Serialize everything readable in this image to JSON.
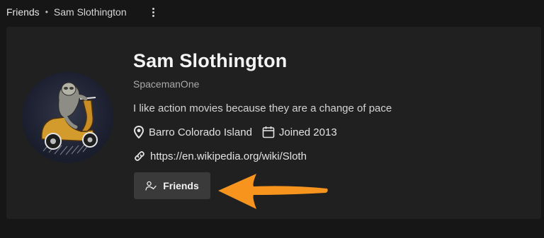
{
  "breadcrumb": {
    "root": "Friends",
    "separator": "•",
    "current": "Sam Slothington"
  },
  "profile": {
    "name": "Sam Slothington",
    "username": "SpacemanOne",
    "bio": "I like action movies because they are a change of pace",
    "location": "Barro Colorado Island",
    "joined": "Joined 2013",
    "website": "https://en.wikipedia.org/wiki/Sloth",
    "avatar_icon": "sloth-on-scooter-illustration"
  },
  "actions": {
    "friends_button_label": "Friends",
    "friends_icon": "user-check-icon"
  },
  "annotation": {
    "arrow_color": "#f7941d"
  },
  "colors": {
    "background": "#161616",
    "card": "#202020",
    "button": "#3a3a3a",
    "accent": "#f7941d"
  }
}
